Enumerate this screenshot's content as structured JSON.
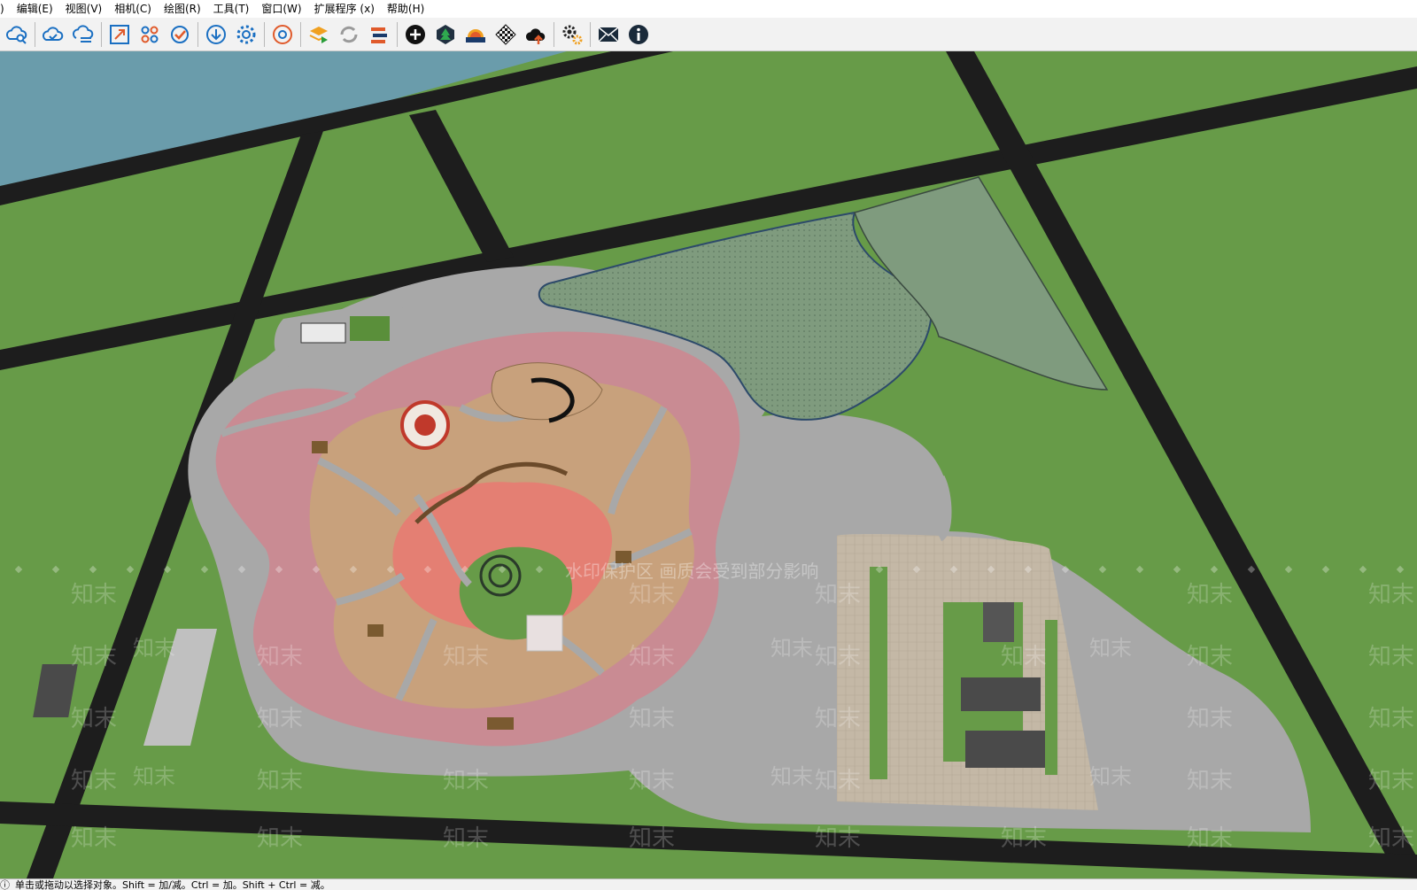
{
  "menu": {
    "items": [
      {
        "id": "file",
        "label": ")"
      },
      {
        "id": "edit",
        "label": "编辑(E)"
      },
      {
        "id": "view",
        "label": "视图(V)"
      },
      {
        "id": "camera",
        "label": "相机(C)"
      },
      {
        "id": "draw",
        "label": "绘图(R)"
      },
      {
        "id": "tools",
        "label": "工具(T)"
      },
      {
        "id": "window",
        "label": "窗口(W)"
      },
      {
        "id": "extensions",
        "label": "扩展程序 (x)"
      },
      {
        "id": "help",
        "label": "帮助(H)"
      }
    ]
  },
  "toolbar": {
    "icons": [
      "cloud-search-icon",
      "cloud-sync-icon",
      "cloud-list-icon",
      "scale-icon",
      "components-icon",
      "check-icon",
      "download-icon",
      "settings-gear-icon",
      "chrome-icon",
      "layers-play-icon",
      "refresh-icon",
      "swap-arrows-icon",
      "add-circle-icon",
      "tree-icon",
      "sunset-icon",
      "checker-icon",
      "cloud-upload-icon",
      "gears-icon",
      "mail-icon",
      "info-icon"
    ]
  },
  "canvas": {
    "watermark_text": "知末",
    "watermark_notice": "水印保护区  画质会受到部分影响",
    "colors": {
      "grass": "#679b48",
      "road": "#1d1d1d",
      "water": "#6a9cab",
      "path": "#a8a8a8",
      "pink": "#c98b93",
      "tan": "#c8a17c",
      "salmon": "#e47f73",
      "pond": "#7f9b7e",
      "plaza": "#c4b8a6"
    }
  },
  "status": {
    "icon": "info-icon",
    "text": "单击或拖动以选择对象。Shift = 加/减。Ctrl = 加。Shift + Ctrl = 减。"
  }
}
